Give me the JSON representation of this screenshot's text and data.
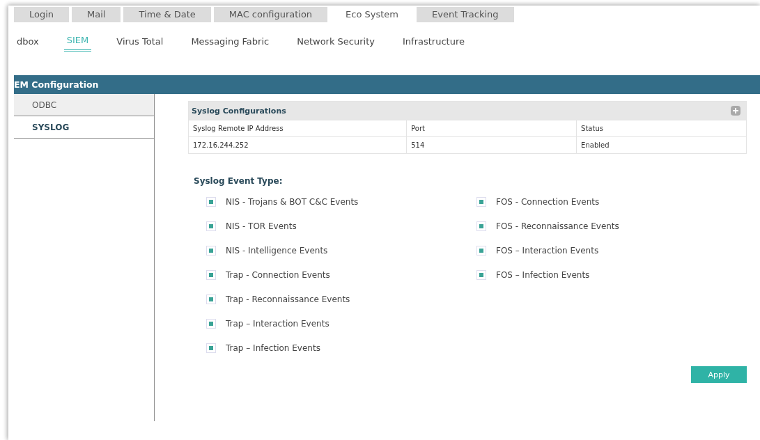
{
  "top_tabs": [
    {
      "label": "Login",
      "selected": false
    },
    {
      "label": "Mail",
      "selected": false
    },
    {
      "label": "Time & Date",
      "selected": false
    },
    {
      "label": "MAC configuration",
      "selected": false
    },
    {
      "label": "Eco System",
      "selected": true
    },
    {
      "label": "Event Tracking",
      "selected": false
    }
  ],
  "sub_tabs": [
    {
      "label": "dbox",
      "selected": false
    },
    {
      "label": "SIEM",
      "selected": true
    },
    {
      "label": "Virus Total",
      "selected": false
    },
    {
      "label": "Messaging Fabric",
      "selected": false
    },
    {
      "label": "Network Security",
      "selected": false
    },
    {
      "label": "Infrastructure",
      "selected": false
    }
  ],
  "section_title": "EM Configuration",
  "sidebar": {
    "items": [
      {
        "label": "ODBC",
        "selected": false
      },
      {
        "label": "SYSLOG",
        "selected": true
      }
    ]
  },
  "table": {
    "title": "Syslog Configurations",
    "columns": [
      "Syslog Remote IP Address",
      "Port",
      "Status"
    ],
    "rows": [
      [
        "172.16.244.252",
        "514",
        "Enabled"
      ]
    ]
  },
  "event_type": {
    "title": "Syslog Event Type:",
    "columns": [
      [
        {
          "label": "NIS - Trojans & BOT C&C Events",
          "checked": true
        },
        {
          "label": "NIS - TOR Events",
          "checked": true
        },
        {
          "label": "NIS - Intelligence Events",
          "checked": true
        },
        {
          "label": "Trap - Connection Events",
          "checked": true
        },
        {
          "label": "Trap - Reconnaissance Events",
          "checked": true
        },
        {
          "label": "Trap – Interaction Events",
          "checked": true
        },
        {
          "label": "Trap – Infection Events",
          "checked": true
        }
      ],
      [
        {
          "label": "FOS - Connection Events",
          "checked": true
        },
        {
          "label": "FOS - Reconnaissance Events",
          "checked": true
        },
        {
          "label": "FOS – Interaction Events",
          "checked": true
        },
        {
          "label": "FOS – Infection Events",
          "checked": true
        }
      ]
    ]
  },
  "apply_button": "Apply"
}
